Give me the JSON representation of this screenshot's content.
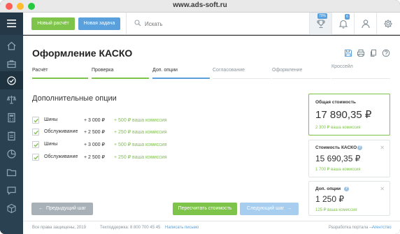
{
  "window": {
    "url": "www.ads-soft.ru"
  },
  "toolbar": {
    "new_calc_label": "Новый расчёт",
    "new_task_label": "Новая задача",
    "search_placeholder": "Искать",
    "trophy_badge": "70%",
    "bell_badge": "6"
  },
  "sidebar": {
    "items": [
      {
        "icon": "home-icon"
      },
      {
        "icon": "briefcase-icon"
      },
      {
        "icon": "check-circle-icon",
        "active": true
      },
      {
        "icon": "scales-icon"
      },
      {
        "icon": "calculator-icon"
      },
      {
        "icon": "clipboard-icon"
      },
      {
        "icon": "pie-chart-icon"
      },
      {
        "icon": "folder-icon"
      },
      {
        "icon": "chat-icon"
      },
      {
        "icon": "box-icon"
      }
    ]
  },
  "page": {
    "title": "Оформление КАСКО"
  },
  "steps": [
    {
      "label": "Расчёт",
      "state": "done"
    },
    {
      "label": "Проверка",
      "state": "done"
    },
    {
      "label": "Доп. опции",
      "state": "active"
    },
    {
      "label": "Согласование",
      "state": "todo"
    },
    {
      "label": "Оформление",
      "state": "todo"
    },
    {
      "label": "Кроссейл",
      "state": "todo"
    }
  ],
  "options": {
    "title": "Дополнительные опции",
    "rows": [
      {
        "name": "Шины",
        "price": "+ 3 000 ₽",
        "commission": "+ 500 ₽ ваша комиссия",
        "checked": true
      },
      {
        "name": "Обслуживание",
        "price": "+ 2 500 ₽",
        "commission": "+ 250 ₽ ваша комиссия",
        "checked": true
      },
      {
        "name": "Шины",
        "price": "+ 3 000 ₽",
        "commission": "+ 500 ₽ ваша комиссия",
        "checked": true
      },
      {
        "name": "Обслуживание",
        "price": "+ 2 500 ₽",
        "commission": "+ 250 ₽ ваша комиссия",
        "checked": true
      }
    ]
  },
  "costs": {
    "total": {
      "label": "Общая стоимость",
      "value": "17 890,35 ₽",
      "commission": "2 300 ₽ ваша комиссия"
    },
    "kasko": {
      "label": "Стоимость КАСКО",
      "value": "15 690,35 ₽",
      "commission": "1 700 ₽ ваша комиссия"
    },
    "options": {
      "label": "Доп. опции",
      "value": "1 250 ₽",
      "commission": "125 ₽ ваша комиссия"
    }
  },
  "actions": {
    "prev_label": "Предыдущий шаг",
    "recalc_label": "Пересчитать стоимость",
    "next_label": "Следующий шаг"
  },
  "footer": {
    "rights": "Все права защищены, 2019",
    "phone_label": "Техподдержка:",
    "phone": "8 800 700 45 45",
    "write_link": "Написать письмо",
    "dev_text": "Разработка портала —",
    "dev_link": "Агентство"
  },
  "colors": {
    "green": "#7ec34a",
    "blue": "#5aa0dc",
    "sidebar": "#2a4152"
  }
}
